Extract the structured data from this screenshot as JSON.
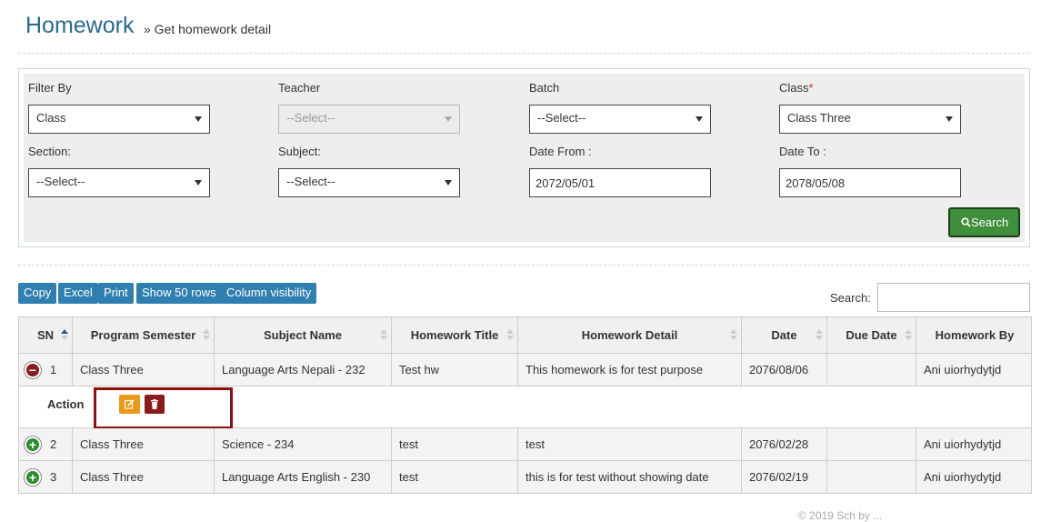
{
  "header": {
    "title": "Homework",
    "breadcrumb": "» Get homework detail"
  },
  "filters": {
    "filter_by": {
      "label": "Filter By",
      "value": "Class"
    },
    "teacher": {
      "label": "Teacher",
      "value": "--Select--"
    },
    "batch": {
      "label": "Batch",
      "value": "--Select--"
    },
    "class": {
      "label": "Class",
      "required_mark": "*",
      "value": "Class Three"
    },
    "section": {
      "label": "Section:",
      "value": "--Select--"
    },
    "subject": {
      "label": "Subject:",
      "value": "--Select--"
    },
    "date_from": {
      "label": "Date From :",
      "value": "2072/05/01"
    },
    "date_to": {
      "label": "Date To :",
      "value": "2078/05/08"
    },
    "search_button": "Search"
  },
  "toolbar": {
    "copy": "Copy",
    "excel": "Excel",
    "print": "Print",
    "show_rows": "Show 50 rows",
    "column_visibility": "Column visibility"
  },
  "table_search": {
    "label": "Search:",
    "value": ""
  },
  "table": {
    "headers": [
      "SN",
      "Program Semester",
      "Subject Name",
      "Homework Title",
      "Homework Detail",
      "Date",
      "Due Date",
      "Homework By"
    ],
    "rows": [
      {
        "sn": "1",
        "program": "Class Three",
        "subject": "Language Arts Nepali - 232",
        "title": "Test hw",
        "detail": "This homework is for test purpose",
        "date": "2076/08/06",
        "due": "",
        "by": "Ani uiorhydytjd"
      },
      {
        "sn": "2",
        "program": "Class Three",
        "subject": "Science - 234",
        "title": "test",
        "detail": "test",
        "date": "2076/02/28",
        "due": "",
        "by": "Ani uiorhydytjd"
      },
      {
        "sn": "3",
        "program": "Class Three",
        "subject": "Language Arts English - 230",
        "title": "test",
        "detail": "this is for test without showing date",
        "date": "2076/02/19",
        "due": "",
        "by": "Ani uiorhydytjd"
      }
    ],
    "child_row": {
      "label": "Action"
    }
  },
  "footer_fragment": "© 2019 Sch by ... ",
  "colors": {
    "title": "#2a6a8e",
    "button_blue": "#2f7fb0",
    "search_green": "#3f8f3c",
    "highlight": "#8b1111",
    "edit": "#e89a1a",
    "delete": "#8b1a1a"
  }
}
